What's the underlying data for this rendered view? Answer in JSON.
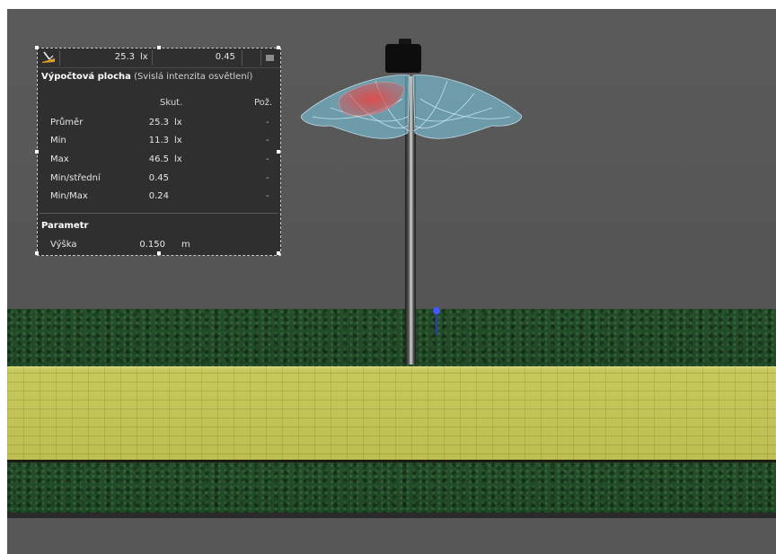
{
  "toolbar": {
    "average_value": "25.3",
    "average_unit": "lx",
    "uniformity_value": "0.45",
    "tool_icon": "calculation-surface-icon",
    "menu_icon": "menu-icon"
  },
  "panel": {
    "title": "Výpočtová plocha",
    "subtitle": "(Svislá intenzita osvětlení)",
    "col_actual": "Skut.",
    "col_required": "Pož.",
    "rows": [
      {
        "label": "Průměr",
        "value": "25.3",
        "unit": "lx",
        "required": "-"
      },
      {
        "label": "Min",
        "value": "11.3",
        "unit": "lx",
        "required": "-"
      },
      {
        "label": "Max",
        "value": "46.5",
        "unit": "lx",
        "required": "-"
      },
      {
        "label": "Min/střední",
        "value": "0.45",
        "unit": "",
        "required": "-"
      },
      {
        "label": "Min/Max",
        "value": "0.24",
        "unit": "",
        "required": "-"
      }
    ],
    "parameter_title": "Parametr",
    "parameter": {
      "label": "Výška",
      "value": "0.150",
      "unit": "m"
    }
  },
  "scene": {
    "background_color": "#575757",
    "grass_color": "#234d29",
    "walkway_color": "#c4c458",
    "photometry_color": "#7fd3ef",
    "hotspot_color": "#e04a4a",
    "marker_color": "#3f52ff"
  }
}
